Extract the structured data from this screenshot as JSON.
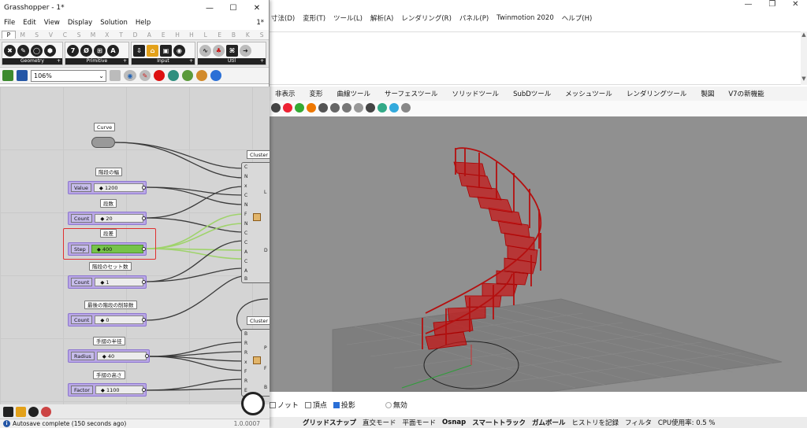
{
  "rhino": {
    "menus": [
      "寸法(D)",
      "変形(T)",
      "ツール(L)",
      "解析(A)",
      "レンダリング(R)",
      "パネル(P)",
      "Twinmotion 2020",
      "ヘルプ(H)"
    ],
    "window_controls": [
      "—",
      "❐",
      "✕"
    ],
    "command_scroll": [
      "▲",
      "▼"
    ],
    "toolbar_tabs": [
      "非表示",
      "変形",
      "曲線ツール",
      "サーフェスツール",
      "ソリッドツール",
      "SubDツール",
      "メッシュツール",
      "レンダリングツール",
      "製図",
      "V7の新機能"
    ],
    "osnap_options": [
      {
        "label": "ノット",
        "checked": false
      },
      {
        "label": "頂点",
        "checked": false
      },
      {
        "label": "投影",
        "checked": true
      }
    ],
    "disable_label": "無効",
    "status_items": [
      {
        "label": "グリッドスナップ",
        "bold": true
      },
      {
        "label": "直交モード",
        "bold": false
      },
      {
        "label": "平面モード",
        "bold": false
      },
      {
        "label": "Osnap",
        "bold": true
      },
      {
        "label": "スマートトラック",
        "bold": true
      },
      {
        "label": "ガムボール",
        "bold": true
      },
      {
        "label": "ヒストリを記録",
        "bold": false
      },
      {
        "label": "フィルタ",
        "bold": false
      },
      {
        "label": "CPU使用率: 0.5 %",
        "bold": false
      }
    ]
  },
  "gh": {
    "title": "Grasshopper - 1*",
    "title_controls": [
      "—",
      "☐",
      "✕"
    ],
    "menus": [
      "File",
      "Edit",
      "View",
      "Display",
      "Solution",
      "Help"
    ],
    "menu_right": "1*",
    "category_tabs": [
      "P",
      "M",
      "S",
      "V",
      "C",
      "S",
      "M",
      "X",
      "T",
      "D",
      "A",
      "E",
      "H",
      "H",
      "L",
      "E",
      "B",
      "K",
      "S"
    ],
    "active_tab_index": 0,
    "ribbon_groups": [
      {
        "name": "Geometry",
        "icons": [
          "✖",
          "✎",
          "◯",
          "⬢",
          "⬡"
        ]
      },
      {
        "name": "Primitive",
        "icons": [
          "7",
          "Ø",
          "⊞",
          "A"
        ]
      },
      {
        "name": "Input",
        "icons": [
          "⇩",
          "⌂",
          "▣",
          "◉"
        ]
      },
      {
        "name": "Util",
        "icons": [
          "∿",
          "♣",
          "⌘",
          "➜"
        ]
      }
    ],
    "zoom_level": "106%",
    "canvas": {
      "curve_label": "Curve",
      "sliders": [
        {
          "caption": "階段の幅",
          "name": "Value",
          "value": "1200",
          "active": false
        },
        {
          "caption": "段数",
          "name": "Count",
          "value": "20",
          "active": false
        },
        {
          "caption": "段差",
          "name": "Step",
          "value": "400",
          "active": true
        },
        {
          "caption": "階段のセット数",
          "name": "Count",
          "value": "1",
          "active": false
        },
        {
          "caption": "最後の階段の削除数",
          "name": "Count",
          "value": "0",
          "active": false
        },
        {
          "caption": "手摺の半径",
          "name": "Radius",
          "value": "40",
          "active": false
        },
        {
          "caption": "手摺の高さ",
          "name": "Factor",
          "value": "1100",
          "active": false
        }
      ],
      "cluster1": {
        "title": "Cluster",
        "inputs": [
          "C",
          "N",
          "x",
          "C",
          "N",
          "F",
          "N",
          "C",
          "C",
          "A",
          "C",
          "A",
          "B"
        ],
        "outputs": [
          "L",
          "D"
        ]
      },
      "cluster2": {
        "title": "Cluster",
        "inputs": [
          "B",
          "R",
          "R",
          "x",
          "F",
          "R",
          "E"
        ],
        "outputs": [
          "P",
          "F",
          "B"
        ]
      }
    },
    "status": "Autosave complete (150 seconds ago)",
    "version": "1.0.0007"
  }
}
